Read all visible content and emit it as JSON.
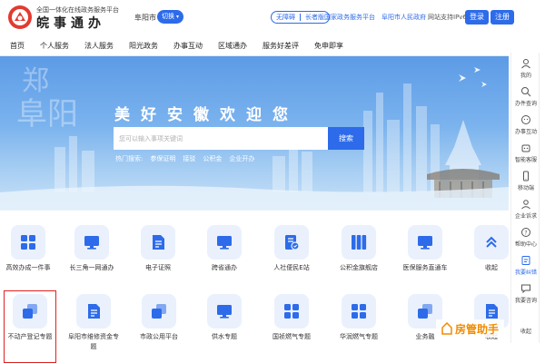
{
  "header": {
    "logo_sub": "全国一体化在线政务服务平台",
    "logo_main": "皖事通办",
    "city": "阜阳市",
    "switch_label": "切换",
    "access_items": [
      "无障碍",
      "长者版"
    ],
    "links": [
      {
        "label": "国家政务服务平台"
      },
      {
        "label": "阜阳市人民政府"
      }
    ],
    "ipv6": "网站支持IPv6",
    "login": "登录",
    "register": "注册"
  },
  "nav": {
    "items": [
      "首页",
      "个人服务",
      "法人服务",
      "阳光政务",
      "办事互动",
      "区域通办",
      "服务好差评",
      "免申即享"
    ]
  },
  "banner": {
    "calligraphy_top": "郑",
    "calligraphy_main": "阜阳",
    "slogan": "美好安徽欢迎您",
    "search_placeholder": "您可以输入事项关键词",
    "search_button": "搜索",
    "hot_label": "热门搜索:",
    "hot_items": [
      "参保证明",
      "接驳",
      "公积金",
      "企业开办"
    ]
  },
  "sidebar": {
    "items": [
      {
        "label": "我的",
        "icon": "user-icon"
      },
      {
        "label": "办件查询",
        "icon": "query-icon"
      },
      {
        "label": "办事互动",
        "icon": "interaction-icon"
      },
      {
        "label": "智能客服",
        "icon": "robot-icon"
      },
      {
        "label": "移动端",
        "icon": "mobile-icon"
      },
      {
        "label": "企业诉求",
        "icon": "enterprise-icon"
      },
      {
        "label": "帮助中心",
        "icon": "help-icon"
      },
      {
        "label": "我要纠错",
        "icon": "correction-icon"
      },
      {
        "label": "我要咨询",
        "icon": "consult-icon"
      },
      {
        "label": "收起",
        "icon": "collapse-icon"
      }
    ]
  },
  "services": {
    "row1": [
      {
        "label": "高效办成一件事",
        "icon": "grid-icon"
      },
      {
        "label": "长三角一网通办",
        "icon": "monitor-icon"
      },
      {
        "label": "电子证照",
        "icon": "document-icon"
      },
      {
        "label": "跨省通办",
        "icon": "monitor-icon"
      },
      {
        "label": "人社便民E站",
        "icon": "id-card-icon"
      },
      {
        "label": "公积金旗舰店",
        "icon": "columns-icon"
      },
      {
        "label": "医保服务直通车",
        "icon": "monitor-icon"
      },
      {
        "label": "收起",
        "icon": "chevron-up-icon"
      }
    ],
    "row2": [
      {
        "label": "不动产登记专题",
        "icon": "layers-icon"
      },
      {
        "label": "阜阳市维修资金专题",
        "icon": "document-icon"
      },
      {
        "label": "市政公用平台",
        "icon": "layers-icon"
      },
      {
        "label": "供水专题",
        "icon": "monitor-icon"
      },
      {
        "label": "国祯燃气专题",
        "icon": "grid-icon"
      },
      {
        "label": "华润燃气专题",
        "icon": "grid-icon"
      },
      {
        "label": "业务融",
        "icon": "layers-icon"
      },
      {
        "label": "收起",
        "icon": "document-icon"
      }
    ]
  },
  "watermark": {
    "text": "房管助手"
  },
  "colors": {
    "accent": "#2d6bea",
    "highlight": "#e02020",
    "watermark": "#f08c00",
    "icon_bg": "#eaf1fd"
  }
}
